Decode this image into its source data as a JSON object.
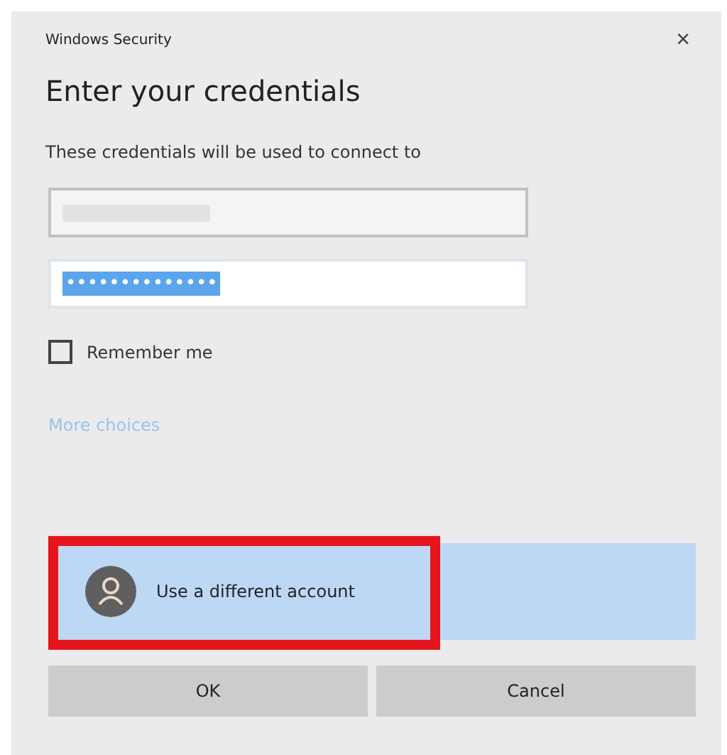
{
  "window": {
    "title": "Windows Security",
    "close": "×"
  },
  "heading": "Enter your credentials",
  "description": "These credentials will be used to connect to",
  "fields": [
    {
      "kind": "redacted",
      "focused": false
    },
    {
      "kind": "password",
      "value": "••••••••••••••",
      "selected": true,
      "focused": true
    }
  ],
  "remember": {
    "label": "Remember me",
    "checked": false
  },
  "more_choices": "More choices",
  "account_option": {
    "label": "Use a different account",
    "selected": true,
    "highlighted": true
  },
  "buttons": [
    "OK",
    "Cancel"
  ]
}
